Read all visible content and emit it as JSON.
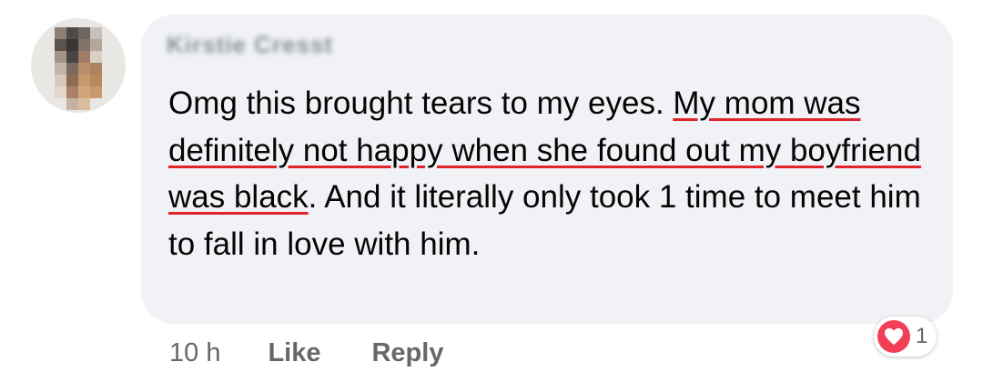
{
  "comment": {
    "author": "Kirstie Cresst",
    "text_parts": {
      "before": "Omg this brought tears to my eyes. ",
      "highlighted": "My mom was definitely not happy when she found out my boyfriend was black",
      "after": ". And it literally only took 1 time to meet him to fall in love with him."
    },
    "timestamp": "10 h",
    "like_label": "Like",
    "reply_label": "Reply",
    "reactions": {
      "icon": "heart-icon",
      "count": "1"
    }
  },
  "colors": {
    "bubble": "#f0f2f5",
    "underline": "#e0252a",
    "love": "#f33e58",
    "meta": "#65676b"
  }
}
